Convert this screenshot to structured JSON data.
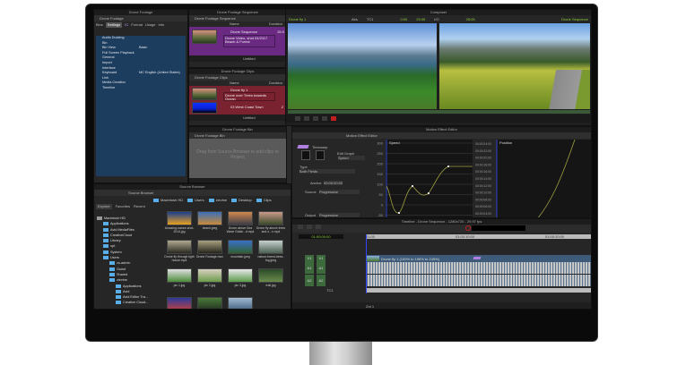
{
  "project": {
    "title": "Drone Footage",
    "tab": "Drone Footage",
    "subtabs": [
      "Bins",
      "Settings",
      "IC",
      "Format",
      "Usage",
      "Info"
    ],
    "settings": [
      {
        "name": "Audio Ducking",
        "value": ""
      },
      {
        "name": "Bin",
        "value": ""
      },
      {
        "name": "Bin View",
        "value": "Basic"
      },
      {
        "name": "Full Screen Playback",
        "value": ""
      },
      {
        "name": "General",
        "value": ""
      },
      {
        "name": "Import",
        "value": ""
      },
      {
        "name": "Interface",
        "value": ""
      },
      {
        "name": "Keyboard",
        "value": "MC English (United States)"
      },
      {
        "name": "Link",
        "value": ""
      },
      {
        "name": "Media Creation",
        "value": ""
      },
      {
        "name": "Timeline",
        "value": ""
      }
    ]
  },
  "seq_bin": {
    "title": "Drone Footage Sequence",
    "tab": "Drone Footage Sequence",
    "col_name": "Name",
    "col_duration": "Duration",
    "item_name": "Drone Sequence",
    "item_duration": "25:0",
    "item_desc": "Drone Video, shot 04/2117 Beach & Forest",
    "view": "Untitled"
  },
  "clips_bin": {
    "title": "Drone Footage Clips",
    "tab": "Drone Footage Clips",
    "col_name": "Name",
    "col_duration": "Duration",
    "item1_name": "Drone fly 1",
    "item1_desc": "Drone over Trees towards Ocean",
    "item2_name": "03 West Coast Town",
    "item2_duration": "2",
    "view": "Untitled"
  },
  "footage_bin": {
    "title": "Drone Footage Bin",
    "tab": "Drone Footage Bin",
    "empty_msg": "Drag from Source Browser to add clips to Project"
  },
  "composer": {
    "title": "Composer",
    "source_clip": "Drone fly 1",
    "abs_label": "Abs",
    "tc_label": "TC1",
    "tc1": "0:00",
    "tc2": "25:05",
    "io_label": "I/O",
    "tc3": "25:05",
    "record_seq": "Drone Sequence"
  },
  "source_browser": {
    "title": "Source Browser",
    "tab": "Source Browser",
    "path": [
      "Macintosh HD",
      "Users",
      "zlevine",
      "Desktop",
      "Clips"
    ],
    "tabs": [
      "Explore",
      "Favorites",
      "Recent"
    ],
    "tree": [
      {
        "label": "Macintosh HD",
        "depth": 0
      },
      {
        "label": "Applications",
        "depth": 1
      },
      {
        "label": "Avid MediaFiles",
        "depth": 1
      },
      {
        "label": "CreativeCloud",
        "depth": 1
      },
      {
        "label": "Library",
        "depth": 1
      },
      {
        "label": "opt",
        "depth": 1
      },
      {
        "label": "System",
        "depth": 1
      },
      {
        "label": "Users",
        "depth": 1
      },
      {
        "label": "cs-admin",
        "depth": 2
      },
      {
        "label": "Guest",
        "depth": 2
      },
      {
        "label": "Shared",
        "depth": 2
      },
      {
        "label": "zlevine",
        "depth": 2
      },
      {
        "label": "Applications",
        "depth": 3
      },
      {
        "label": "Avid",
        "depth": 3
      },
      {
        "label": "Avid Editor Tra...",
        "depth": 3
      },
      {
        "label": "Creative Cloud...",
        "depth": 3
      },
      {
        "label": "Desktop",
        "depth": 3
      }
    ],
    "files": [
      {
        "name": "Amazing-nature-shot-2014.jpg",
        "c1": "#1b3f8f",
        "c2": "#e8a020"
      },
      {
        "name": "beach.jpeg",
        "c1": "#3b6fb8",
        "c2": "#c98a3a"
      },
      {
        "name": "Drone above Sea Wave Golde...d.mp4",
        "c1": "#d08a50",
        "c2": "#3c3c46"
      },
      {
        "name": "Drone fly above trees and o...n.mp4",
        "c1": "#c99a8a",
        "c2": "#3a4a2a"
      },
      {
        "name": "Drone fly through light house.mp4",
        "c1": "#b0a890",
        "c2": "#2a2a22"
      },
      {
        "name": "Drone Footage.mov",
        "c1": "#a8a080",
        "c2": "#25251c"
      },
      {
        "name": "mountain.jpeg",
        "c1": "#3a70c8",
        "c2": "#306030"
      },
      {
        "name": "nature-forest-trees-fog.jpeg",
        "c1": "#c8d0d0",
        "c2": "#4a6050"
      },
      {
        "name": "pic 1.jpg",
        "c1": "#e0e0e0",
        "c2": "#4a8a3a"
      },
      {
        "name": "pic 2.jpg",
        "c1": "#d8d0c0",
        "c2": "#6a9a4a"
      },
      {
        "name": "pic 3.jpg",
        "c1": "#e8e8e8",
        "c2": "#5a9a4a"
      },
      {
        "name": "trail.jpg",
        "c1": "#2a4a2a",
        "c2": "#6a8a4a"
      },
      {
        "name": "",
        "c1": "#2a3a9a",
        "c2": "#c04040"
      },
      {
        "name": "",
        "c1": "#4a7a3a",
        "c2": "#203020"
      },
      {
        "name": "",
        "c1": "#a0b8d0",
        "c2": "#406080"
      }
    ]
  },
  "motion": {
    "title": "Motion Effect Editor",
    "tab": "Motion Effect Editor",
    "effect": "Timewarp",
    "edit_graph_label": "Edit Graph",
    "edit_graph_value": "Speed",
    "type_label": "Type",
    "type_value": "Both Fields",
    "anchor_label": "Anchor",
    "anchor_value": "00:00:00:00",
    "source_label": "Source",
    "source_value": "Progressive",
    "output_label": "Output",
    "output_value": "Progressive",
    "speed_title": "Speed",
    "position_title": "Position",
    "speed_ticks": [
      "300",
      "250",
      "200",
      "150",
      "100",
      "50",
      "0",
      "-50"
    ],
    "position_ticks": [
      "00:00:24:00",
      "00:00:22:00",
      "00:00:20:00",
      "00:00:18:00",
      "00:00:16:00",
      "00:00:14:00",
      "00:00:12:00",
      "00:00:10:00",
      "00:00:08:00",
      "00:00:06:00",
      "00:00:04:00"
    ]
  },
  "timeline": {
    "title": "Timeline - Drone Sequence - 1280x720 - 29.97 fps",
    "timecode": "01:00:00:00",
    "ruler": [
      "01:00",
      "01:00:10:00",
      "01:00:20:00"
    ],
    "tracks": [
      "V1",
      "A1",
      "A2"
    ],
    "tc_track": "TC1",
    "clip_label": "Drone fly 1 (100% to 196% to 245%)",
    "zoom": "Zot 1"
  },
  "colors": {
    "settings_bg": "#1d3d5e",
    "seq_bin": "#6a2a82",
    "clips_bin": "#7a2230",
    "accent_green": "#8fd13a",
    "track_green": "#3d6a3d",
    "clip_blue": "#3d5a78"
  }
}
